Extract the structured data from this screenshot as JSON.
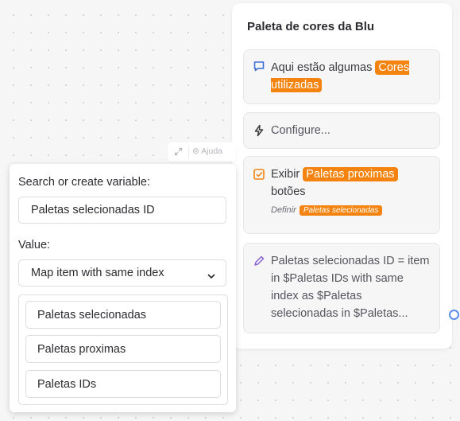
{
  "card": {
    "title": "Paleta de cores da Blu",
    "node1": {
      "text": "Aqui estão algumas ",
      "tag": "Cores utilizadas"
    },
    "node2": {
      "text": "Configure..."
    },
    "node3": {
      "text": "Exibir ",
      "tag": "Paletas proximas",
      "text2": "botões",
      "define_label": "Definir",
      "define_tag": "Paletas selecionadas"
    },
    "node4": {
      "text": "Paletas selecionadas ID = item in $Paletas IDs with same index as $Paletas selecionadas in $Paletas..."
    }
  },
  "toolbar": {
    "help_label": "Ajuda"
  },
  "panel": {
    "search_label": "Search or create variable:",
    "search_value": "Paletas selecionadas ID",
    "value_label": "Value:",
    "value_select": "Map item with same index",
    "options": [
      "Paletas selecionadas",
      "Paletas proximas",
      "Paletas IDs"
    ]
  },
  "colors": {
    "accent": "#f4840f",
    "link": "#5b8def",
    "edit_icon": "#8a63d2"
  },
  "icons": {
    "node1": "chat-bubble-icon",
    "node2": "lightning-icon",
    "node3": "checkbox-icon",
    "node4": "pencil-icon"
  }
}
